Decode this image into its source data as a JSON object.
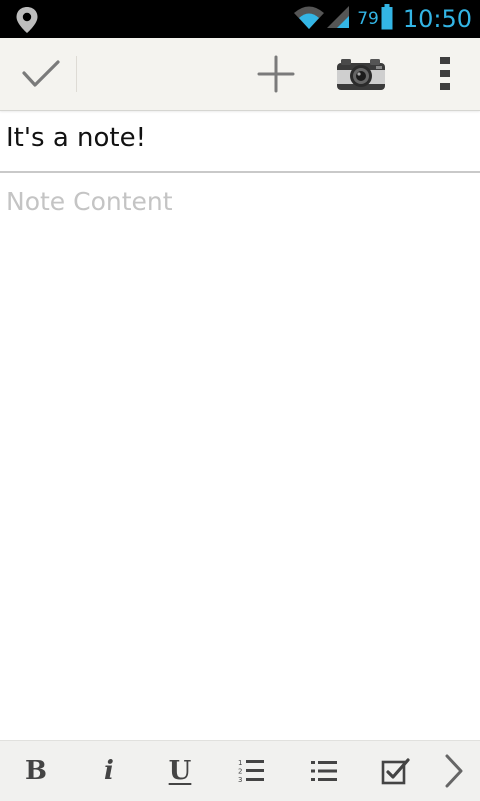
{
  "status_bar": {
    "battery_percent": "79",
    "time": "10:50",
    "icons": [
      "location-icon",
      "wifi-icon",
      "signal-icon",
      "battery-icon"
    ]
  },
  "action_bar": {
    "icons": [
      "checkmark-icon",
      "plus-icon",
      "camera-icon",
      "overflow-menu-icon"
    ]
  },
  "note": {
    "title": "It's a note!",
    "content_placeholder": "Note Content"
  },
  "format_bar": {
    "bold_label": "B",
    "italic_label": "i",
    "underline_label": "U",
    "icons": [
      "numbered-list-icon",
      "bulleted-list-icon",
      "checkbox-icon",
      "chevron-right-icon"
    ]
  },
  "colors": {
    "status_accent": "#33b5e5",
    "action_bar_bg": "#f4f3ef",
    "title_divider": "#c9c9c9",
    "placeholder_text": "#c4c4c4"
  }
}
